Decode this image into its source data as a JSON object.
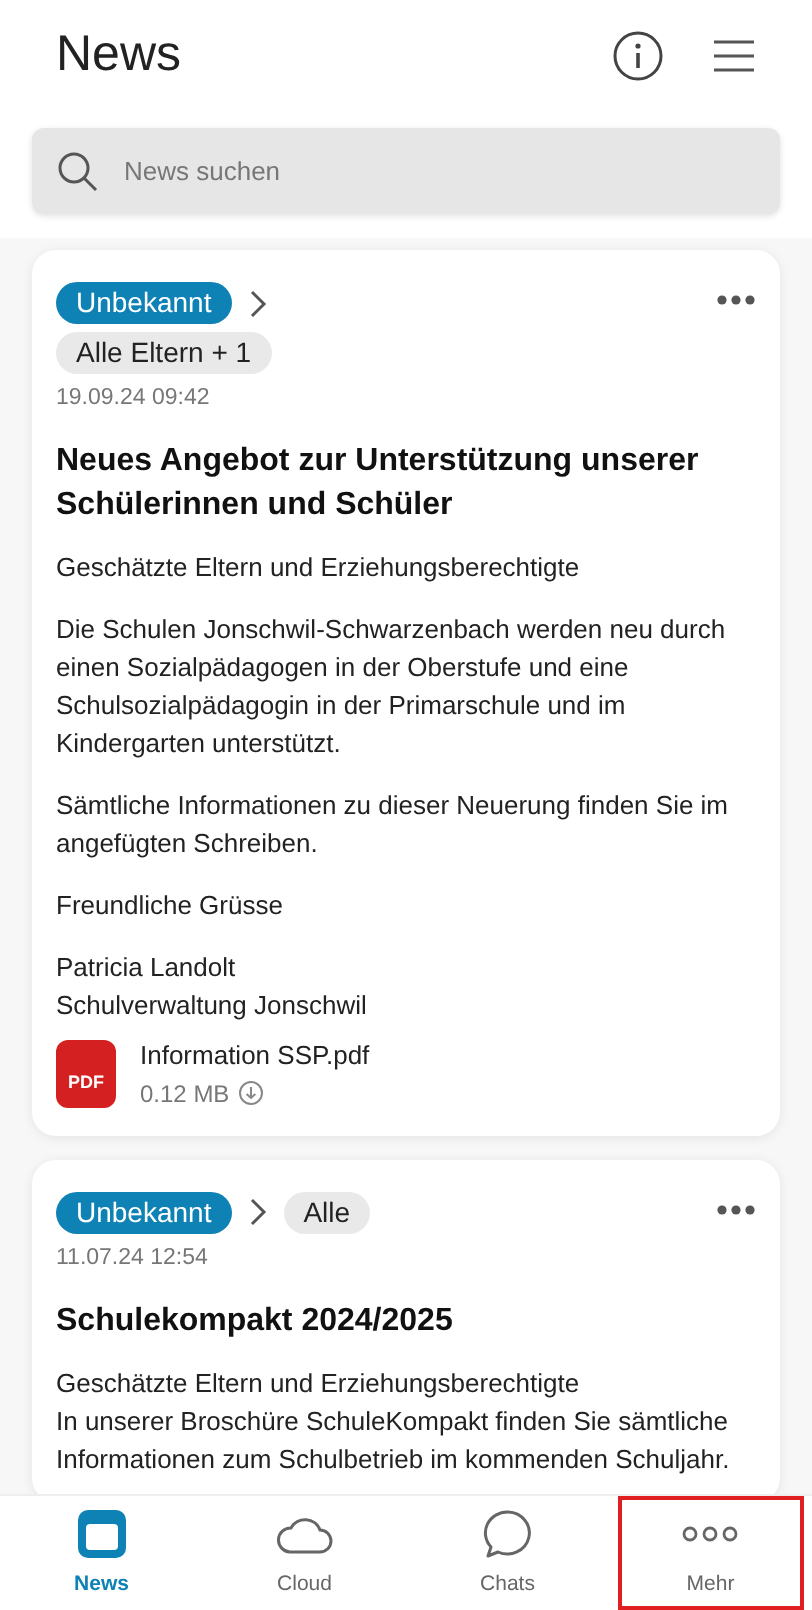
{
  "header": {
    "title": "News"
  },
  "search": {
    "placeholder": "News suchen"
  },
  "posts": [
    {
      "status": "Unbekannt",
      "audience": "Alle Eltern + 1",
      "audience_wrapped": true,
      "date": "19.09.24 09:42",
      "title": "Neues Angebot zur Unterstützung unserer Schülerinnen und Schüler",
      "paragraphs": [
        "Geschätzte Eltern und Erziehungsberechtigte",
        "Die Schulen Jonschwil-Schwarzenbach werden neu durch einen Sozialpädagogen in der Oberstufe und eine Schulsozialpädagogin in der Primarschule und im Kindergarten unterstützt.",
        "Sämtliche Informationen zu dieser Neuerung finden Sie im angefügten Schreiben.",
        "Freundliche Grüsse",
        "Patricia Landolt\nSchulverwaltung Jonschwil"
      ],
      "attachment": {
        "badge": "PDF",
        "name": "Information SSP.pdf",
        "size": "0.12 MB"
      }
    },
    {
      "status": "Unbekannt",
      "audience": "Alle",
      "audience_wrapped": false,
      "date": "11.07.24 12:54",
      "title": "Schulekompakt 2024/2025",
      "paragraphs": [
        "Geschätzte Eltern und Erziehungsberechtigte\nIn unserer Broschüre SchuleKompakt finden Sie sämtliche Informationen zum Schulbetrieb im kommenden Schuljahr."
      ]
    }
  ],
  "tabs": [
    {
      "label": "News",
      "kind": "news",
      "selected": true,
      "highlighted": false
    },
    {
      "label": "Cloud",
      "kind": "cloud",
      "selected": false,
      "highlighted": false
    },
    {
      "label": "Chats",
      "kind": "chats",
      "selected": false,
      "highlighted": false
    },
    {
      "label": "Mehr",
      "kind": "more",
      "selected": false,
      "highlighted": true
    }
  ]
}
